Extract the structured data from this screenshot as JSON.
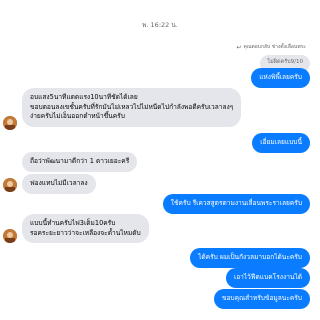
{
  "timestamp": "พ. 16:22 น.",
  "reply": {
    "note": "คุณตอบกลับ ช่างตั้งเลื่อนพระ",
    "quoted": "ไม่ผิดครับ9/10"
  },
  "messages": [
    {
      "side": "out",
      "text": "แห่งพิพี้เลยครับ"
    },
    {
      "side": "in",
      "text": "อบแสง5นาทีแดดแรง10นาทีชัดได้เลย\nขอบตอนลงเขชั้นครับที่รักมันไม่เหลวไปไม่หนีดไปกำลังพอดีครับเวลาลงๆ\nง่ายครับไม่เอ็นออกตำหน้าขึ้นครับ"
    },
    {
      "side": "out",
      "text": "เอี่ยมเลยแบบนี้"
    },
    {
      "side": "in",
      "text": "ถือว่าพัฒนามาดีกว่า 1 ดาวเยอะครี"
    },
    {
      "side": "in",
      "text": "ฟองแทบไม่มีเวลาลง"
    },
    {
      "side": "out",
      "text": "ใช้ครับ รีเควสสูตรตามงานเลื่อนพระราเลยครับ"
    },
    {
      "side": "in",
      "text": "แบบนี้ทำนครับไฟ3เต็ม10ครับ\nรอคระยะยาวว่าจะเหลืองจะด้ำนไหมดับ"
    },
    {
      "side": "out",
      "text": "ได้ครับ ผมเป็นกังวลมาบอกได้นะครับ"
    },
    {
      "side": "out",
      "text": "เอาไว้ฟีดแบคโรงงานได้"
    },
    {
      "side": "out",
      "text": "ขอบคุณสำหรับข้อมูลนะครับ"
    }
  ]
}
